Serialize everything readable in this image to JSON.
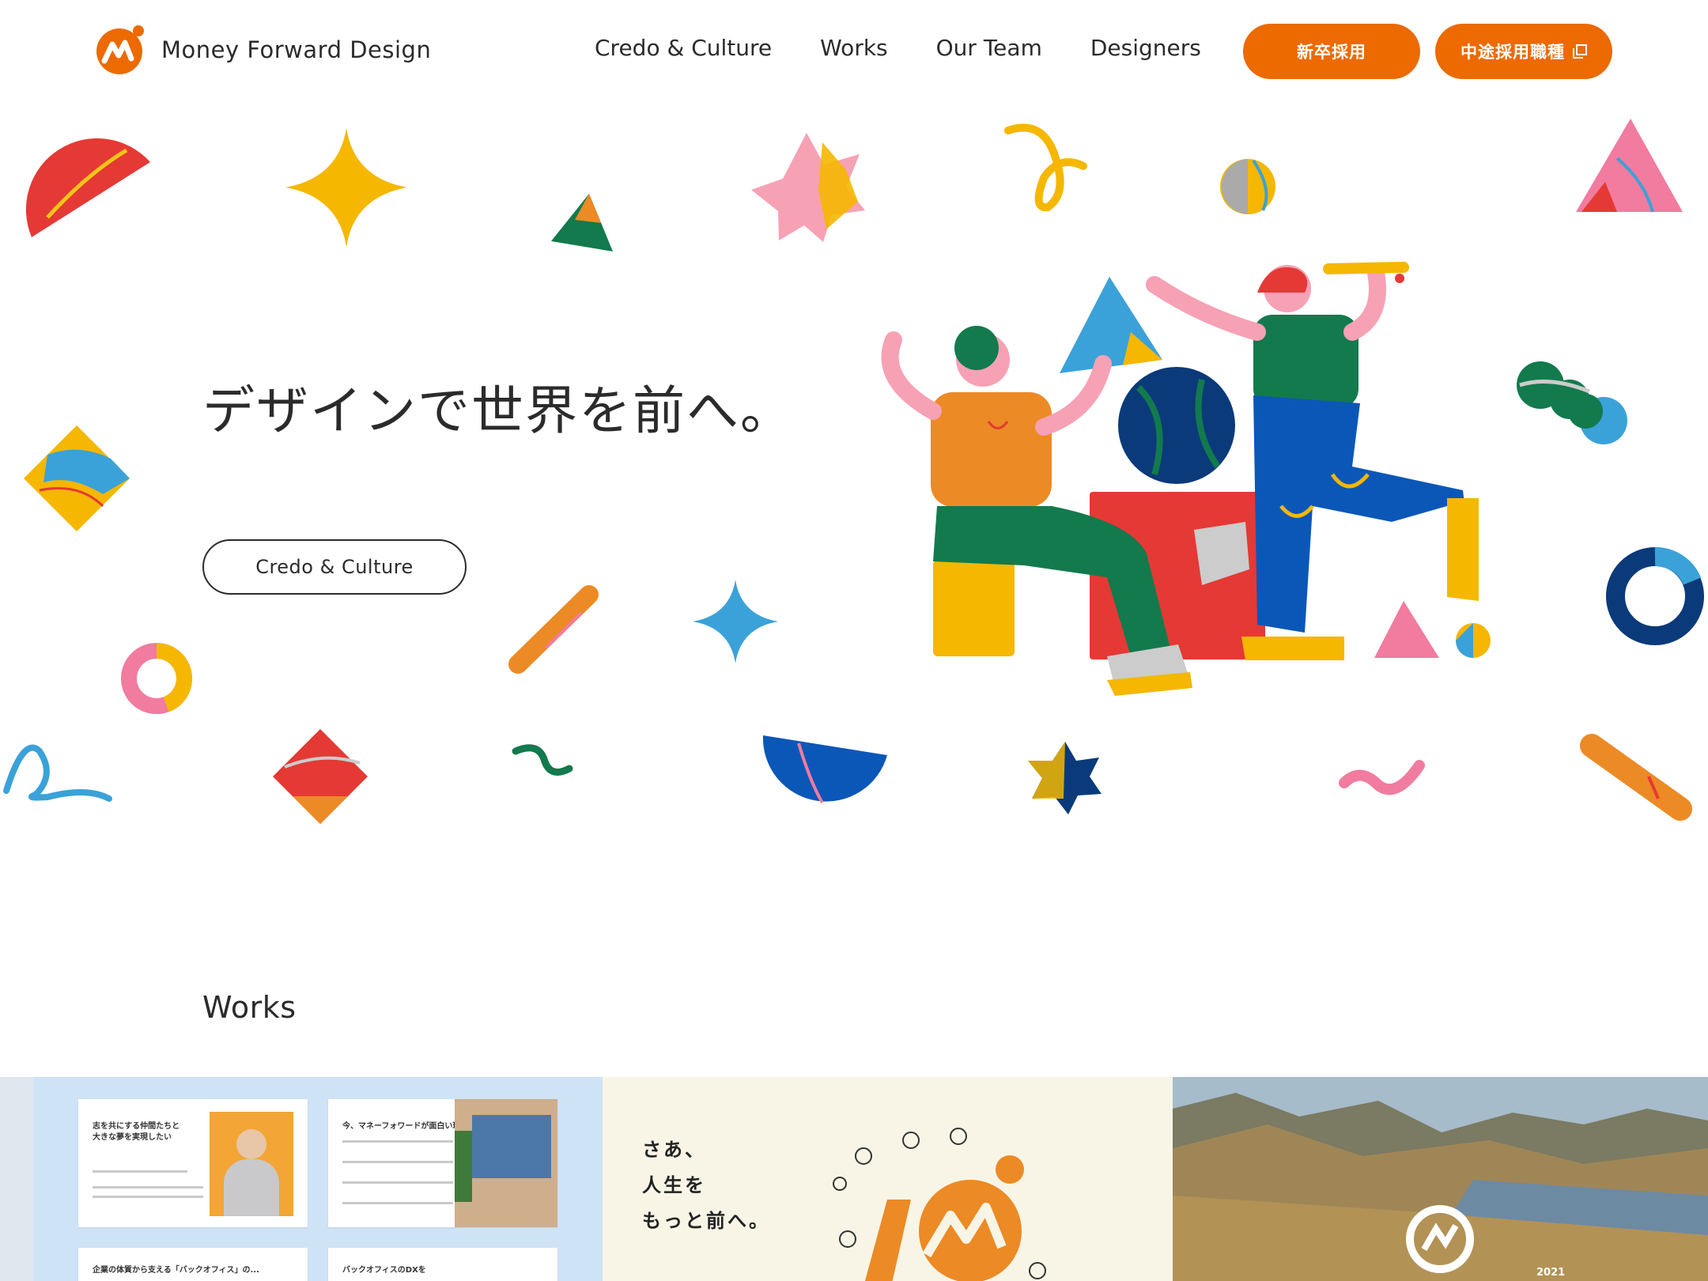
{
  "header": {
    "logo_text": "Money Forward Design",
    "nav": [
      "Credo & Culture",
      "Works",
      "Our Team",
      "Designers"
    ],
    "btn_new_grad": "新卒採用",
    "btn_mid_career": "中途採用職種"
  },
  "hero": {
    "title": "デザインで世界を前へ。",
    "cta": "Credo & Culture"
  },
  "works": {
    "heading": "Works",
    "card1": {
      "doc1_title": "志を共にする仲間たちと\n大きな夢を実現したい",
      "doc2_title": "今、マネーフォワードが面白い理由",
      "doc3_title": "企業の体質から支える「バックオフィス」の...",
      "doc4_title": "バックオフィスのDXを"
    },
    "card2": {
      "text": "さあ、\n人生を\nもっと前へ。"
    },
    "card3": {
      "year": "2021"
    }
  },
  "colors": {
    "accent": "#ec6a00",
    "text": "#2b2b2b"
  }
}
